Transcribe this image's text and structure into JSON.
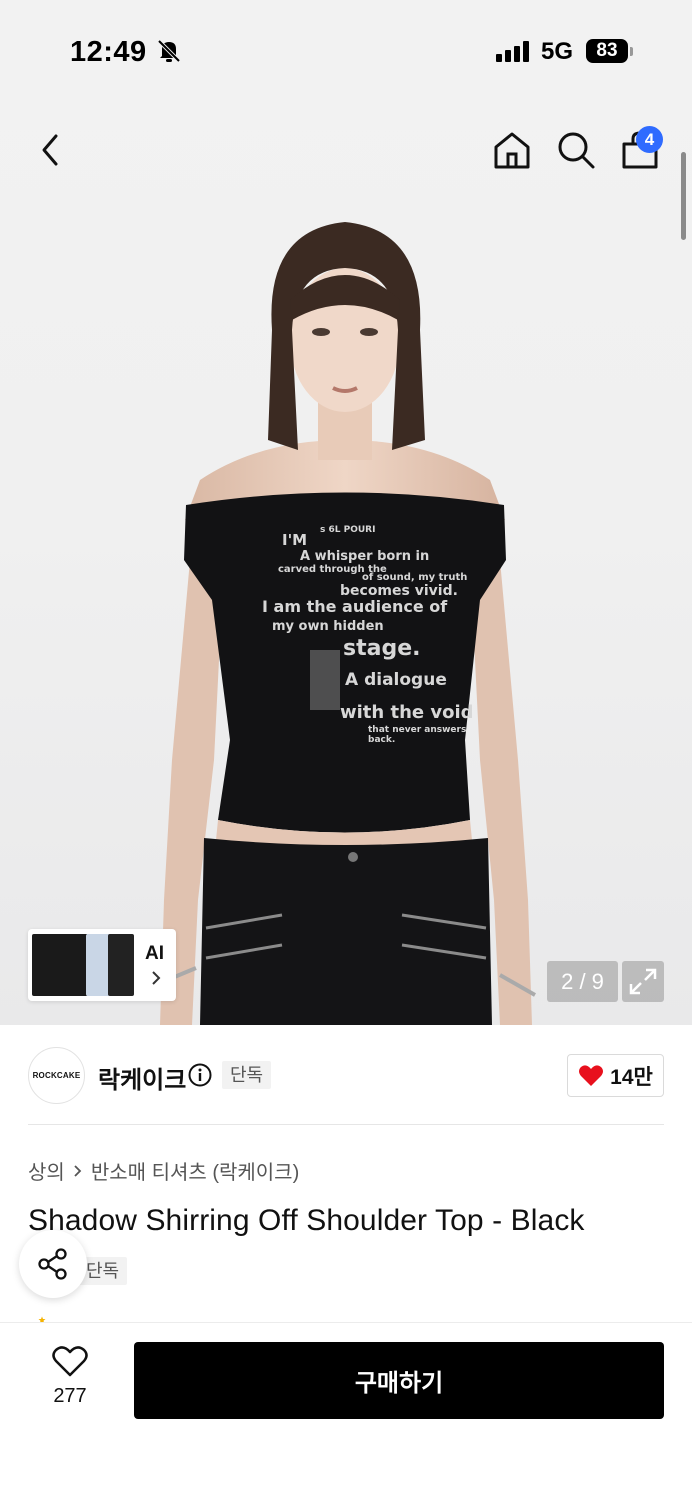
{
  "status_bar": {
    "time": "12:49",
    "network": "5G",
    "battery": "83"
  },
  "header": {
    "cart_badge": "4"
  },
  "gallery": {
    "ai_label": "AI",
    "counter": "2 / 9",
    "shirt_print": [
      "I'M",
      "s  6L POURI",
      "A whisper born in",
      "carved through the",
      "of sound, my truth",
      "becomes vivid.",
      "I am the audience of",
      "my own hidden",
      "stage.",
      "A dialogue",
      "with the void",
      "that never answers",
      "back."
    ]
  },
  "brand": {
    "logo_text": "ROCKCAKE",
    "name": "락케이크",
    "exclusive_tag": "단독",
    "likes": "14만"
  },
  "product": {
    "breadcrumb": [
      "상의",
      "반소매 티셔츠 (락케이크)"
    ],
    "title": "Shadow Shirring Off Shoulder Top - Black",
    "exclusive_tag": "단독"
  },
  "bottom_bar": {
    "wish_count": "277",
    "buy_label": "구매하기"
  },
  "colors": {
    "accent_blue": "#2f6bff",
    "heart_red": "#e8101d",
    "buy_button": "#000000"
  }
}
